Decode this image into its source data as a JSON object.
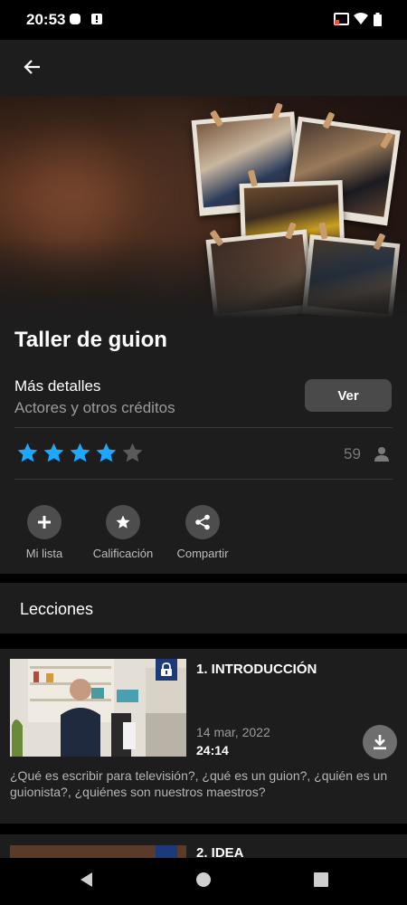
{
  "status_bar": {
    "time": "20:53",
    "icons": [
      "circle-notification-icon",
      "alert-notification-icon",
      "cast-icon",
      "wifi-icon",
      "battery-icon"
    ]
  },
  "app_bar": {
    "back_icon": "arrow-back-icon"
  },
  "course": {
    "title": "Taller de guion",
    "details_title": "Más detalles",
    "details_subtitle": "Actores y otros créditos",
    "watch_button": "Ver",
    "rating": 4,
    "rating_max": 5,
    "rating_count": "59"
  },
  "actions": [
    {
      "label": "Mi lista",
      "icon": "plus-icon"
    },
    {
      "label": "Calificación",
      "icon": "star-icon"
    },
    {
      "label": "Compartir",
      "icon": "share-icon"
    }
  ],
  "lessons": {
    "header": "Lecciones",
    "items": [
      {
        "title": "1. INTRODUCCIÓN",
        "date": "14 mar, 2022",
        "duration": "24:14",
        "description": "¿Qué es escribir para televisión?, ¿qué es un guion?, ¿quién es un guionista?, ¿quiénes son nuestros maestros?"
      },
      {
        "title": "2. IDEA"
      }
    ]
  },
  "colors": {
    "accent_star": "#1ea7ff",
    "surface": "#1d1d1d",
    "lock_badge": "#1c3a7a"
  }
}
